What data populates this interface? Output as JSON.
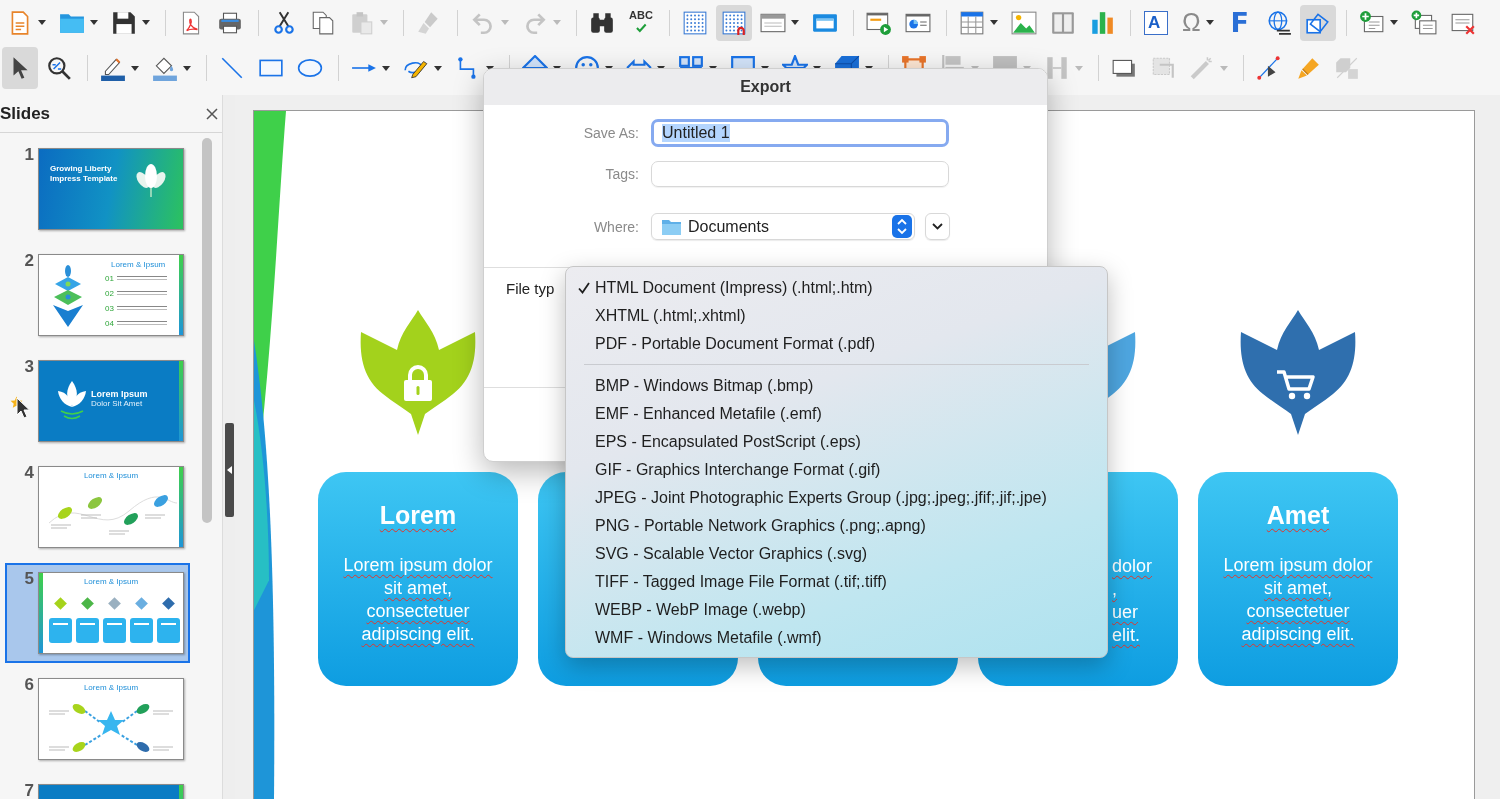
{
  "toolbars": [
    {
      "groups": [
        [
          {
            "pressed": false,
            "disabled": false
          },
          {
            "pressed": false,
            "disabled": false
          },
          {
            "pressed": false,
            "disabled": false
          }
        ],
        [
          {
            "pressed": false,
            "disabled": false
          },
          {
            "pressed": false,
            "disabled": false
          }
        ],
        [
          {
            "pressed": false,
            "disabled": false
          },
          {
            "pressed": false,
            "disabled": false
          },
          {
            "pressed": false,
            "disabled": true
          }
        ],
        [
          {
            "pressed": false,
            "disabled": true
          }
        ],
        [
          {
            "pressed": false,
            "disabled": true
          },
          {
            "pressed": false,
            "disabled": true
          }
        ],
        [
          {
            "pressed": false,
            "disabled": false
          },
          {
            "pressed": false,
            "disabled": false,
            "glyph": "ABC"
          }
        ],
        [
          {
            "pressed": false,
            "disabled": false
          },
          {
            "pressed": true,
            "disabled": false
          },
          {
            "pressed": false,
            "disabled": false
          },
          {
            "pressed": false,
            "disabled": false
          }
        ],
        [
          {
            "pressed": false,
            "disabled": false
          },
          {
            "pressed": false,
            "disabled": false
          }
        ],
        [
          {
            "pressed": false,
            "disabled": false
          },
          {
            "pressed": false,
            "disabled": false
          },
          {
            "pressed": false,
            "disabled": false
          },
          {
            "pressed": false,
            "disabled": false
          }
        ],
        [
          {
            "pressed": false,
            "disabled": false,
            "glyph": "A"
          },
          {
            "pressed": false,
            "disabled": false,
            "glyph": "Ω"
          },
          {
            "pressed": false,
            "disabled": false,
            "glyph": "F"
          },
          {
            "pressed": false,
            "disabled": false
          },
          {
            "pressed": true,
            "disabled": false
          }
        ],
        [
          {
            "pressed": false,
            "disabled": false
          },
          {
            "pressed": false,
            "disabled": false
          },
          {
            "pressed": false,
            "disabled": false
          }
        ]
      ]
    },
    {
      "groups": [
        [
          {
            "pressed": true,
            "disabled": false
          },
          {
            "pressed": false,
            "disabled": false
          }
        ],
        [
          {
            "pressed": false,
            "disabled": false
          },
          {
            "pressed": false,
            "disabled": false
          }
        ],
        [
          {
            "pressed": false,
            "disabled": false
          },
          {
            "pressed": false,
            "disabled": false
          },
          {
            "pressed": false,
            "disabled": false
          }
        ],
        [
          {
            "pressed": false,
            "disabled": false
          },
          {
            "pressed": false,
            "disabled": false
          },
          {
            "pressed": false,
            "disabled": false
          }
        ],
        [
          {
            "pressed": false,
            "disabled": false
          },
          {
            "pressed": false,
            "disabled": false
          },
          {
            "pressed": false,
            "disabled": false
          },
          {
            "pressed": false,
            "disabled": false
          },
          {
            "pressed": false,
            "disabled": false
          },
          {
            "pressed": false,
            "disabled": false
          },
          {
            "pressed": false,
            "disabled": false
          }
        ],
        [
          {
            "pressed": false,
            "disabled": false
          },
          {
            "pressed": false,
            "disabled": true
          },
          {
            "pressed": false,
            "disabled": true
          },
          {
            "pressed": false,
            "disabled": true
          }
        ],
        [
          {
            "pressed": false,
            "disabled": false
          },
          {
            "pressed": false,
            "disabled": true
          },
          {
            "pressed": false,
            "disabled": true
          }
        ],
        [
          {
            "pressed": false,
            "disabled": false
          },
          {
            "pressed": false,
            "disabled": false
          },
          {
            "pressed": false,
            "disabled": true
          }
        ]
      ]
    }
  ],
  "slides_panel": {
    "title": "Slides",
    "slides": [
      {
        "number": "1",
        "kind": "title",
        "selected": false,
        "has_effect": false,
        "title": "Growing Liberty Impress Template"
      },
      {
        "number": "2",
        "kind": "list",
        "selected": false,
        "has_effect": false,
        "title": "Lorem & Ipsum",
        "items": [
          "01",
          "02",
          "03",
          "04"
        ]
      },
      {
        "number": "3",
        "kind": "section",
        "selected": false,
        "has_effect": true,
        "title": "Lorem Ipsum",
        "subtitle": "Dolor Sit Amet"
      },
      {
        "number": "4",
        "kind": "timeline",
        "selected": false,
        "has_effect": false,
        "title": "Lorem & Ipsum"
      },
      {
        "number": "5",
        "kind": "cards",
        "selected": true,
        "has_effect": false,
        "title": "Lorem & Ipsum"
      },
      {
        "number": "6",
        "kind": "star",
        "selected": false,
        "has_effect": false,
        "title": "Lorem & Ipsum"
      },
      {
        "number": "7",
        "kind": "section",
        "selected": false,
        "has_effect": false
      }
    ]
  },
  "slide": {
    "columns": [
      {
        "kind": "full",
        "leaf": {
          "color": "#a3d21c"
        },
        "title": "Lorem",
        "text": "Lorem ipsum dolor sit amet, consectetuer adipiscing elit."
      },
      {
        "kind": "blank"
      },
      {
        "kind": "blank"
      },
      {
        "kind": "partial",
        "leaf": {
          "color": "#4ea6e0"
        },
        "lines": [
          "dolor",
          ",",
          "uer",
          "elit."
        ]
      },
      {
        "kind": "full",
        "leaf": {
          "color": "#2f6fae"
        },
        "title": "Amet",
        "text": "Lorem ipsum dolor sit amet, consectetuer adipiscing elit."
      }
    ]
  },
  "dialog": {
    "title": "Export",
    "save_as": {
      "label": "Save As:",
      "value": "Untitled 1",
      "focused": true,
      "text_selected": true
    },
    "tags": {
      "label": "Tags:"
    },
    "where": {
      "label": "Where:",
      "value": "Documents"
    },
    "file_type": {
      "label": "File typ",
      "menu": {
        "groups": [
          [
            {
              "label": "HTML Document (Impress) (.html;.htm)",
              "selected": true
            },
            {
              "label": "XHTML (.html;.xhtml)",
              "selected": false
            },
            {
              "label": "PDF - Portable Document Format (.pdf)",
              "selected": false
            }
          ],
          [
            {
              "label": "BMP - Windows Bitmap (.bmp)",
              "selected": false
            },
            {
              "label": "EMF - Enhanced Metafile (.emf)",
              "selected": false
            },
            {
              "label": "EPS - Encapsulated PostScript (.eps)",
              "selected": false
            },
            {
              "label": "GIF - Graphics Interchange Format (.gif)",
              "selected": false
            },
            {
              "label": "JPEG - Joint Photographic Experts Group (.jpg;.jpeg;.jfif;.jif;.jpe)",
              "selected": false
            },
            {
              "label": "PNG - Portable Network Graphics (.png;.apng)",
              "selected": false
            },
            {
              "label": "SVG - Scalable Vector Graphics (.svg)",
              "selected": false
            },
            {
              "label": "TIFF - Tagged Image File Format (.tif;.tiff)",
              "selected": false
            },
            {
              "label": "WEBP - WebP Image (.webp)",
              "selected": false
            },
            {
              "label": "WMF - Windows Metafile (.wmf)",
              "selected": false
            }
          ]
        ]
      }
    }
  }
}
